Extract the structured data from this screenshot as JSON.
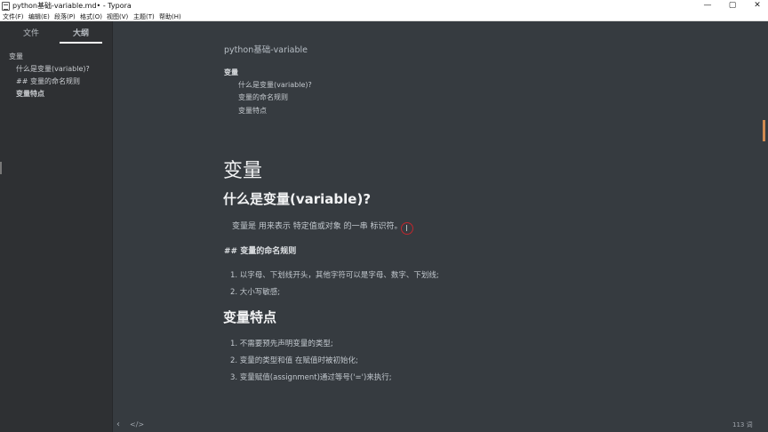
{
  "window": {
    "title": "python基础-variable.md• - Typora",
    "controls": {
      "minimize": "—",
      "maximize": "▢",
      "close": "✕"
    }
  },
  "menu": [
    "文件(F)",
    "编辑(E)",
    "段落(P)",
    "格式(O)",
    "视图(V)",
    "主题(T)",
    "帮助(H)"
  ],
  "sidebar": {
    "tabs": [
      "文件",
      "大纲"
    ],
    "active_tab": "大纲",
    "outline": [
      "变量",
      "什么是变量(variable)?",
      "## 变量的命名规则",
      "变量特点"
    ]
  },
  "document": {
    "title": "python基础-variable",
    "toc": {
      "heading": "变量",
      "items": [
        "什么是变量(variable)?",
        "变量的命名规则",
        "变量特点"
      ]
    },
    "h1": "变量",
    "section1": {
      "heading": "什么是变量(variable)?",
      "paragraph": "变量是 用来表示 特定值或对象 的一串 标识符。"
    },
    "section2": {
      "heading": "## 变量的命名规则",
      "items": [
        "1. 以字母、下划线开头，其他字符可以是字母、数字、下划线;",
        "2. 大小写敏感;"
      ]
    },
    "section3": {
      "heading": "变量特点",
      "items": [
        "1. 不需要预先声明变量的类型;",
        "2. 变量的类型和值 在赋值时被初始化;",
        "3. 变量赋值(assignment)通过等号('=')来执行;"
      ]
    }
  },
  "statusbar": {
    "sidebar_toggle": "‹",
    "source_toggle": "</>",
    "word_count": "113 词"
  },
  "colors": {
    "editor_bg": "#363b40",
    "sidebar_bg": "#2e3033",
    "scroll_thumb": "#d08a51",
    "cursor_ring": "#c0272d"
  }
}
